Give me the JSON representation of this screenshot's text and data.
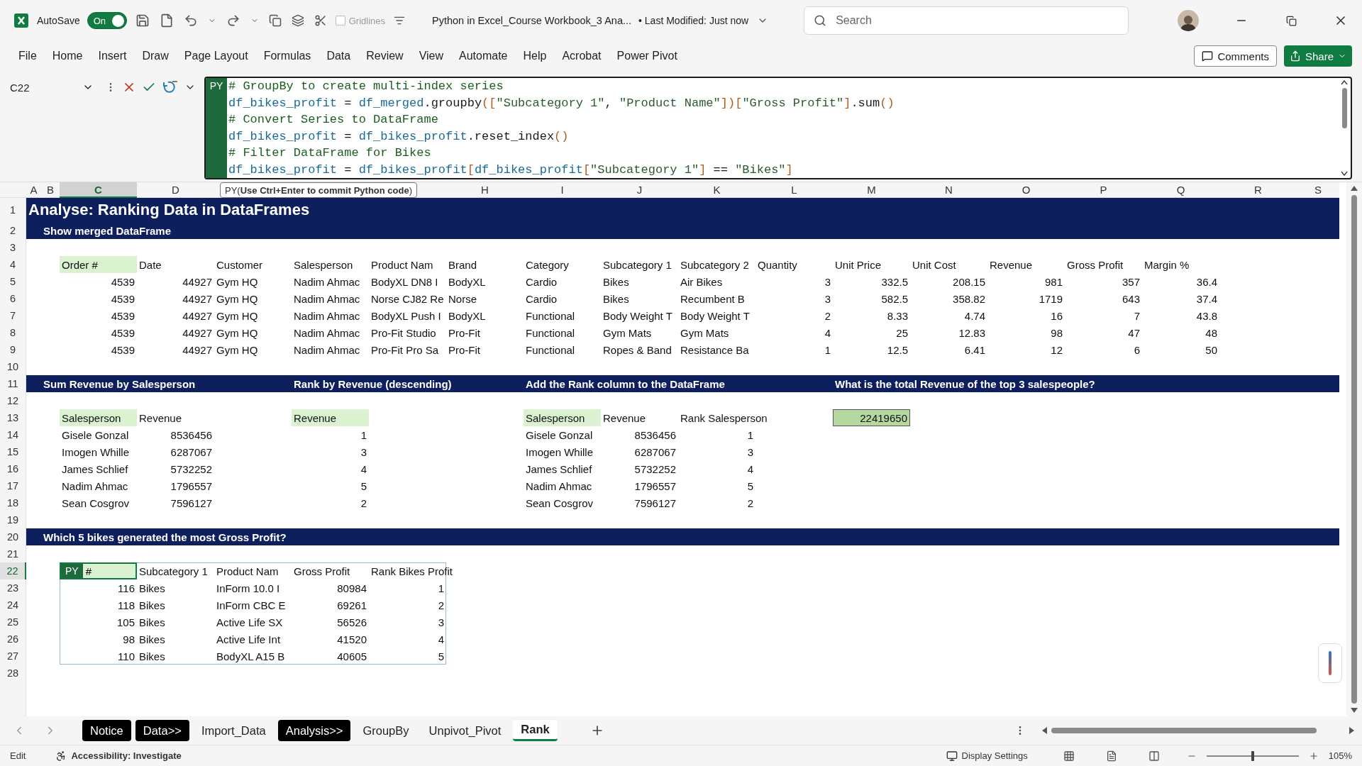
{
  "title_bar": {
    "autosave_label": "AutoSave",
    "autosave": {
      "label": "On",
      "on": true
    },
    "gridlines": {
      "label": "Gridlines",
      "checked": false
    },
    "doc_title": "Python in Excel_Course Workbook_3 Ana...",
    "modified": "• Last Modified: Just now",
    "search": {
      "placeholder": "Search"
    }
  },
  "menu": [
    "File",
    "Home",
    "Insert",
    "Draw",
    "Page Layout",
    "Formulas",
    "Data",
    "Review",
    "View",
    "Automate",
    "Help",
    "Acrobat",
    "Power Pivot"
  ],
  "comments_button": "Comments",
  "share_button": "Share",
  "formula_bar": {
    "name_box": "C22",
    "badge": "PY",
    "code": [
      [
        {
          "kind": "comment",
          "text": "# GroupBy to create multi-index series"
        }
      ],
      [
        {
          "kind": "name",
          "text": "df_bikes_profit"
        },
        {
          "kind": "plain",
          "text": " = "
        },
        {
          "kind": "name",
          "text": "df_merged"
        },
        {
          "kind": "plain",
          "text": ".groupby"
        },
        {
          "kind": "bracket",
          "text": "(["
        },
        {
          "kind": "string",
          "text": "\"Subcategory 1\""
        },
        {
          "kind": "plain",
          "text": ", "
        },
        {
          "kind": "string",
          "text": "\"Product Name\""
        },
        {
          "kind": "bracket",
          "text": "])["
        },
        {
          "kind": "string",
          "text": "\"Gross Profit\""
        },
        {
          "kind": "bracket",
          "text": "]"
        },
        {
          "kind": "plain",
          "text": ".sum"
        },
        {
          "kind": "bracket",
          "text": "()"
        }
      ],
      [
        {
          "kind": "comment",
          "text": "# Convert Series to DataFrame"
        }
      ],
      [
        {
          "kind": "name",
          "text": "df_bikes_profit"
        },
        {
          "kind": "plain",
          "text": " = "
        },
        {
          "kind": "name",
          "text": "df_bikes_profit"
        },
        {
          "kind": "plain",
          "text": ".reset_index"
        },
        {
          "kind": "bracket",
          "text": "()"
        }
      ],
      [
        {
          "kind": "comment",
          "text": "# Filter DataFrame for Bikes"
        }
      ],
      [
        {
          "kind": "name",
          "text": "df_bikes_profit"
        },
        {
          "kind": "plain",
          "text": " = "
        },
        {
          "kind": "name",
          "text": "df_bikes_profit"
        },
        {
          "kind": "bracket",
          "text": "["
        },
        {
          "kind": "name",
          "text": "df_bikes_profit"
        },
        {
          "kind": "bracket",
          "text": "["
        },
        {
          "kind": "string",
          "text": "\"Subcategory 1\""
        },
        {
          "kind": "bracket",
          "text": "]"
        },
        {
          "kind": "plain",
          "text": " == "
        },
        {
          "kind": "string",
          "text": "\"Bikes\""
        },
        {
          "kind": "bracket",
          "text": "]"
        }
      ]
    ]
  },
  "tooltip": "PY(**Use Ctrl+Enter to commit Python code**)",
  "sheet": {
    "columns": [
      {
        "label": "A",
        "selected": false
      },
      {
        "label": "B",
        "selected": false
      },
      {
        "label": "C",
        "selected": true
      },
      {
        "label": "D",
        "selected": false
      },
      null,
      null,
      null,
      {
        "label": "H",
        "selected": false
      },
      {
        "label": "I",
        "selected": false
      },
      {
        "label": "J",
        "selected": false
      },
      {
        "label": "K",
        "selected": false
      },
      {
        "label": "L",
        "selected": false
      },
      {
        "label": "M",
        "selected": false
      },
      {
        "label": "N",
        "selected": false
      },
      {
        "label": "O",
        "selected": false
      },
      {
        "label": "P",
        "selected": false
      },
      {
        "label": "Q",
        "selected": false
      },
      {
        "label": "R",
        "selected": false
      },
      {
        "label": "S",
        "selected": false
      }
    ],
    "rows": [
      {
        "number": "1",
        "selected": false,
        "banner": true,
        "cells": [
          {
            "kind": "title",
            "text": "Analyse: Ranking Data in DataFrames"
          }
        ]
      },
      {
        "number": "2",
        "selected": false,
        "banner": true,
        "cells": [
          "",
          {
            "kind": "banner",
            "text": "Show merged DataFrame"
          }
        ]
      },
      {
        "number": "3",
        "selected": false,
        "banner": false
      },
      {
        "number": "4",
        "selected": false,
        "banner": false,
        "cells": [
          "",
          "",
          {
            "kind": "header",
            "text": "Order #"
          },
          {
            "kind": "text",
            "text": "Date"
          },
          {
            "kind": "text",
            "text": "Customer"
          },
          {
            "kind": "text",
            "text": "Salesperson"
          },
          {
            "kind": "text",
            "text": "Product Nam"
          },
          {
            "kind": "text",
            "text": "Brand"
          },
          {
            "kind": "text",
            "text": "Category"
          },
          {
            "kind": "text",
            "text": "Subcategory 1"
          },
          {
            "kind": "text",
            "text": "Subcategory 2"
          },
          {
            "kind": "text",
            "text": "Quantity"
          },
          {
            "kind": "text",
            "text": "Unit Price"
          },
          {
            "kind": "text",
            "text": "Unit Cost"
          },
          {
            "kind": "text",
            "text": "Revenue"
          },
          {
            "kind": "text",
            "text": "Gross Profit"
          },
          {
            "kind": "text",
            "text": "Margin %"
          }
        ]
      },
      {
        "number": "5",
        "selected": false,
        "banner": false,
        "cells": [
          "",
          "",
          {
            "kind": "number",
            "text": "4539"
          },
          {
            "kind": "number",
            "text": "44927"
          },
          {
            "kind": "text",
            "text": "Gym HQ"
          },
          {
            "kind": "text",
            "text": "Nadim Ahmac"
          },
          {
            "kind": "text",
            "text": "BodyXL DN8 I"
          },
          {
            "kind": "text",
            "text": "BodyXL"
          },
          {
            "kind": "text",
            "text": "Cardio"
          },
          {
            "kind": "text",
            "text": "Bikes"
          },
          {
            "kind": "text",
            "text": "Air Bikes"
          },
          {
            "kind": "number",
            "text": "3"
          },
          {
            "kind": "number",
            "text": "332.5"
          },
          {
            "kind": "number",
            "text": "208.15"
          },
          {
            "kind": "number",
            "text": "981"
          },
          {
            "kind": "number",
            "text": "357"
          },
          {
            "kind": "number",
            "text": "36.4"
          }
        ]
      },
      {
        "number": "6",
        "selected": false,
        "banner": false,
        "cells": [
          "",
          "",
          {
            "kind": "number",
            "text": "4539"
          },
          {
            "kind": "number",
            "text": "44927"
          },
          {
            "kind": "text",
            "text": "Gym HQ"
          },
          {
            "kind": "text",
            "text": "Nadim Ahmac"
          },
          {
            "kind": "text",
            "text": "Norse CJ82 Re"
          },
          {
            "kind": "text",
            "text": "Norse"
          },
          {
            "kind": "text",
            "text": "Cardio"
          },
          {
            "kind": "text",
            "text": "Bikes"
          },
          {
            "kind": "text",
            "text": "Recumbent B"
          },
          {
            "kind": "number",
            "text": "3"
          },
          {
            "kind": "number",
            "text": "582.5"
          },
          {
            "kind": "number",
            "text": "358.82"
          },
          {
            "kind": "number",
            "text": "1719"
          },
          {
            "kind": "number",
            "text": "643"
          },
          {
            "kind": "number",
            "text": "37.4"
          }
        ]
      },
      {
        "number": "7",
        "selected": false,
        "banner": false,
        "cells": [
          "",
          "",
          {
            "kind": "number",
            "text": "4539"
          },
          {
            "kind": "number",
            "text": "44927"
          },
          {
            "kind": "text",
            "text": "Gym HQ"
          },
          {
            "kind": "text",
            "text": "Nadim Ahmac"
          },
          {
            "kind": "text",
            "text": "BodyXL Push I"
          },
          {
            "kind": "text",
            "text": "BodyXL"
          },
          {
            "kind": "text",
            "text": "Functional"
          },
          {
            "kind": "text",
            "text": "Body Weight T"
          },
          {
            "kind": "text",
            "text": "Body Weight T"
          },
          {
            "kind": "number",
            "text": "2"
          },
          {
            "kind": "number",
            "text": "8.33"
          },
          {
            "kind": "number",
            "text": "4.74"
          },
          {
            "kind": "number",
            "text": "16"
          },
          {
            "kind": "number",
            "text": "7"
          },
          {
            "kind": "number",
            "text": "43.8"
          }
        ]
      },
      {
        "number": "8",
        "selected": false,
        "banner": false,
        "cells": [
          "",
          "",
          {
            "kind": "number",
            "text": "4539"
          },
          {
            "kind": "number",
            "text": "44927"
          },
          {
            "kind": "text",
            "text": "Gym HQ"
          },
          {
            "kind": "text",
            "text": "Nadim Ahmac"
          },
          {
            "kind": "text",
            "text": "Pro-Fit Studio"
          },
          {
            "kind": "text",
            "text": "Pro-Fit"
          },
          {
            "kind": "text",
            "text": "Functional"
          },
          {
            "kind": "text",
            "text": "Gym Mats"
          },
          {
            "kind": "text",
            "text": "Gym Mats"
          },
          {
            "kind": "number",
            "text": "4"
          },
          {
            "kind": "number",
            "text": "25"
          },
          {
            "kind": "number",
            "text": "12.83"
          },
          {
            "kind": "number",
            "text": "98"
          },
          {
            "kind": "number",
            "text": "47"
          },
          {
            "kind": "number",
            "text": "48"
          }
        ]
      },
      {
        "number": "9",
        "selected": false,
        "banner": false,
        "cells": [
          "",
          "",
          {
            "kind": "number",
            "text": "4539"
          },
          {
            "kind": "number",
            "text": "44927"
          },
          {
            "kind": "text",
            "text": "Gym HQ"
          },
          {
            "kind": "text",
            "text": "Nadim Ahmac"
          },
          {
            "kind": "text",
            "text": "Pro-Fit Pro Sa"
          },
          {
            "kind": "text",
            "text": "Pro-Fit"
          },
          {
            "kind": "text",
            "text": "Functional"
          },
          {
            "kind": "text",
            "text": "Ropes & Band"
          },
          {
            "kind": "text",
            "text": "Resistance Ba"
          },
          {
            "kind": "number",
            "text": "1"
          },
          {
            "kind": "number",
            "text": "12.5"
          },
          {
            "kind": "number",
            "text": "6.41"
          },
          {
            "kind": "number",
            "text": "12"
          },
          {
            "kind": "number",
            "text": "6"
          },
          {
            "kind": "number",
            "text": "50"
          }
        ]
      },
      {
        "number": "10",
        "selected": false,
        "banner": false
      },
      {
        "number": "11",
        "selected": false,
        "banner": true,
        "cells": [
          "",
          {
            "kind": "banner",
            "text": "Sum Revenue by Salesperson"
          },
          "",
          "",
          "",
          {
            "kind": "banner",
            "text": "Rank by Revenue (descending)"
          },
          "",
          "",
          {
            "kind": "banner",
            "text": "Add the Rank column to the DataFrame"
          },
          "",
          "",
          "",
          {
            "kind": "banner",
            "text": "What is the total Revenue of the top 3 salespeople?"
          }
        ]
      },
      {
        "number": "12",
        "selected": false,
        "banner": false
      },
      {
        "number": "13",
        "selected": false,
        "banner": false,
        "cells": [
          "",
          "",
          {
            "kind": "header",
            "text": "Salesperson"
          },
          {
            "kind": "text",
            "text": "Revenue"
          },
          "",
          {
            "kind": "header",
            "text": "Revenue"
          },
          "",
          "",
          {
            "kind": "header",
            "text": "Salesperson"
          },
          {
            "kind": "text",
            "text": "Revenue"
          },
          {
            "kind": "text",
            "text": "Rank Salesperson"
          },
          "",
          {
            "kind": "answer",
            "text": "22419650"
          }
        ]
      },
      {
        "number": "14",
        "selected": false,
        "banner": false,
        "cells": [
          "",
          "",
          {
            "kind": "text",
            "text": "Gisele Gonzal"
          },
          {
            "kind": "number",
            "text": "8536456"
          },
          "",
          {
            "kind": "number",
            "text": "1"
          },
          "",
          "",
          {
            "kind": "text",
            "text": "Gisele Gonzal"
          },
          {
            "kind": "number",
            "text": "8536456"
          },
          {
            "kind": "number",
            "text": "1"
          }
        ]
      },
      {
        "number": "15",
        "selected": false,
        "banner": false,
        "cells": [
          "",
          "",
          {
            "kind": "text",
            "text": "Imogen Whille"
          },
          {
            "kind": "number",
            "text": "6287067"
          },
          "",
          {
            "kind": "number",
            "text": "3"
          },
          "",
          "",
          {
            "kind": "text",
            "text": "Imogen Whille"
          },
          {
            "kind": "number",
            "text": "6287067"
          },
          {
            "kind": "number",
            "text": "3"
          }
        ]
      },
      {
        "number": "16",
        "selected": false,
        "banner": false,
        "cells": [
          "",
          "",
          {
            "kind": "text",
            "text": "James Schlief"
          },
          {
            "kind": "number",
            "text": "5732252"
          },
          "",
          {
            "kind": "number",
            "text": "4"
          },
          "",
          "",
          {
            "kind": "text",
            "text": "James Schlief"
          },
          {
            "kind": "number",
            "text": "5732252"
          },
          {
            "kind": "number",
            "text": "4"
          }
        ]
      },
      {
        "number": "17",
        "selected": false,
        "banner": false,
        "cells": [
          "",
          "",
          {
            "kind": "text",
            "text": "Nadim Ahmac"
          },
          {
            "kind": "number",
            "text": "1796557"
          },
          "",
          {
            "kind": "number",
            "text": "5"
          },
          "",
          "",
          {
            "kind": "text",
            "text": "Nadim Ahmac"
          },
          {
            "kind": "number",
            "text": "1796557"
          },
          {
            "kind": "number",
            "text": "5"
          }
        ]
      },
      {
        "number": "18",
        "selected": false,
        "banner": false,
        "cells": [
          "",
          "",
          {
            "kind": "text",
            "text": "Sean Cosgrov"
          },
          {
            "kind": "number",
            "text": "7596127"
          },
          "",
          {
            "kind": "number",
            "text": "2"
          },
          "",
          "",
          {
            "kind": "text",
            "text": "Sean Cosgrov"
          },
          {
            "kind": "number",
            "text": "7596127"
          },
          {
            "kind": "number",
            "text": "2"
          }
        ]
      },
      {
        "number": "19",
        "selected": false,
        "banner": false
      },
      {
        "number": "20",
        "selected": false,
        "banner": true,
        "cells": [
          "",
          {
            "kind": "banner",
            "text": "Which 5 bikes generated the most Gross Profit?"
          }
        ]
      },
      {
        "number": "21",
        "selected": false,
        "banner": false
      },
      {
        "number": "22",
        "selected": true,
        "banner": false,
        "cells": [
          "",
          "",
          {
            "kind": "py-header",
            "badge": "PY",
            "text": "#"
          },
          {
            "kind": "text",
            "text": "Subcategory 1"
          },
          {
            "kind": "text",
            "text": "Product Nam"
          },
          {
            "kind": "text",
            "text": "Gross Profit"
          },
          {
            "kind": "text",
            "text": "Rank Bikes Profit"
          }
        ]
      },
      {
        "number": "23",
        "selected": false,
        "banner": false,
        "cells": [
          "",
          "",
          {
            "kind": "number",
            "text": "116"
          },
          {
            "kind": "text",
            "text": "Bikes"
          },
          {
            "kind": "text",
            "text": "InForm 10.0 I"
          },
          {
            "kind": "number",
            "text": "80984"
          },
          {
            "kind": "number",
            "text": "1"
          }
        ]
      },
      {
        "number": "24",
        "selected": false,
        "banner": false,
        "cells": [
          "",
          "",
          {
            "kind": "number",
            "text": "118"
          },
          {
            "kind": "text",
            "text": "Bikes"
          },
          {
            "kind": "text",
            "text": "InForm CBC E"
          },
          {
            "kind": "number",
            "text": "69261"
          },
          {
            "kind": "number",
            "text": "2"
          }
        ]
      },
      {
        "number": "25",
        "selected": false,
        "banner": false,
        "cells": [
          "",
          "",
          {
            "kind": "number",
            "text": "105"
          },
          {
            "kind": "text",
            "text": "Bikes"
          },
          {
            "kind": "text",
            "text": "Active Life SX"
          },
          {
            "kind": "number",
            "text": "56526"
          },
          {
            "kind": "number",
            "text": "3"
          }
        ]
      },
      {
        "number": "26",
        "selected": false,
        "banner": false,
        "cells": [
          "",
          "",
          {
            "kind": "number",
            "text": "98"
          },
          {
            "kind": "text",
            "text": "Bikes"
          },
          {
            "kind": "text",
            "text": "Active Life Int"
          },
          {
            "kind": "number",
            "text": "41520"
          },
          {
            "kind": "number",
            "text": "4"
          }
        ]
      },
      {
        "number": "27",
        "selected": false,
        "banner": false,
        "cells": [
          "",
          "",
          {
            "kind": "number",
            "text": "110"
          },
          {
            "kind": "text",
            "text": "Bikes"
          },
          {
            "kind": "text",
            "text": "BodyXL A15 B"
          },
          {
            "kind": "number",
            "text": "40605"
          },
          {
            "kind": "number",
            "text": "5"
          }
        ]
      },
      {
        "number": "28",
        "selected": false,
        "banner": false
      }
    ]
  },
  "sheet_tabs": [
    {
      "label": "Notice",
      "selected": false,
      "color": "#000000"
    },
    {
      "label": "Data>>",
      "selected": false,
      "color": "#000000"
    },
    {
      "label": "Import_Data",
      "selected": false
    },
    {
      "label": "Analysis>>",
      "selected": false,
      "color": "#000000"
    },
    {
      "label": "GroupBy",
      "selected": false
    },
    {
      "label": "Unpivot_Pivot",
      "selected": false
    },
    {
      "label": "Rank",
      "selected": true
    }
  ],
  "status_bar": {
    "mode": "Edit",
    "accessibility": "Accessibility: Investigate",
    "display_settings": "Display Settings",
    "zoom": {
      "level": 0.5,
      "reading": "105%"
    }
  }
}
